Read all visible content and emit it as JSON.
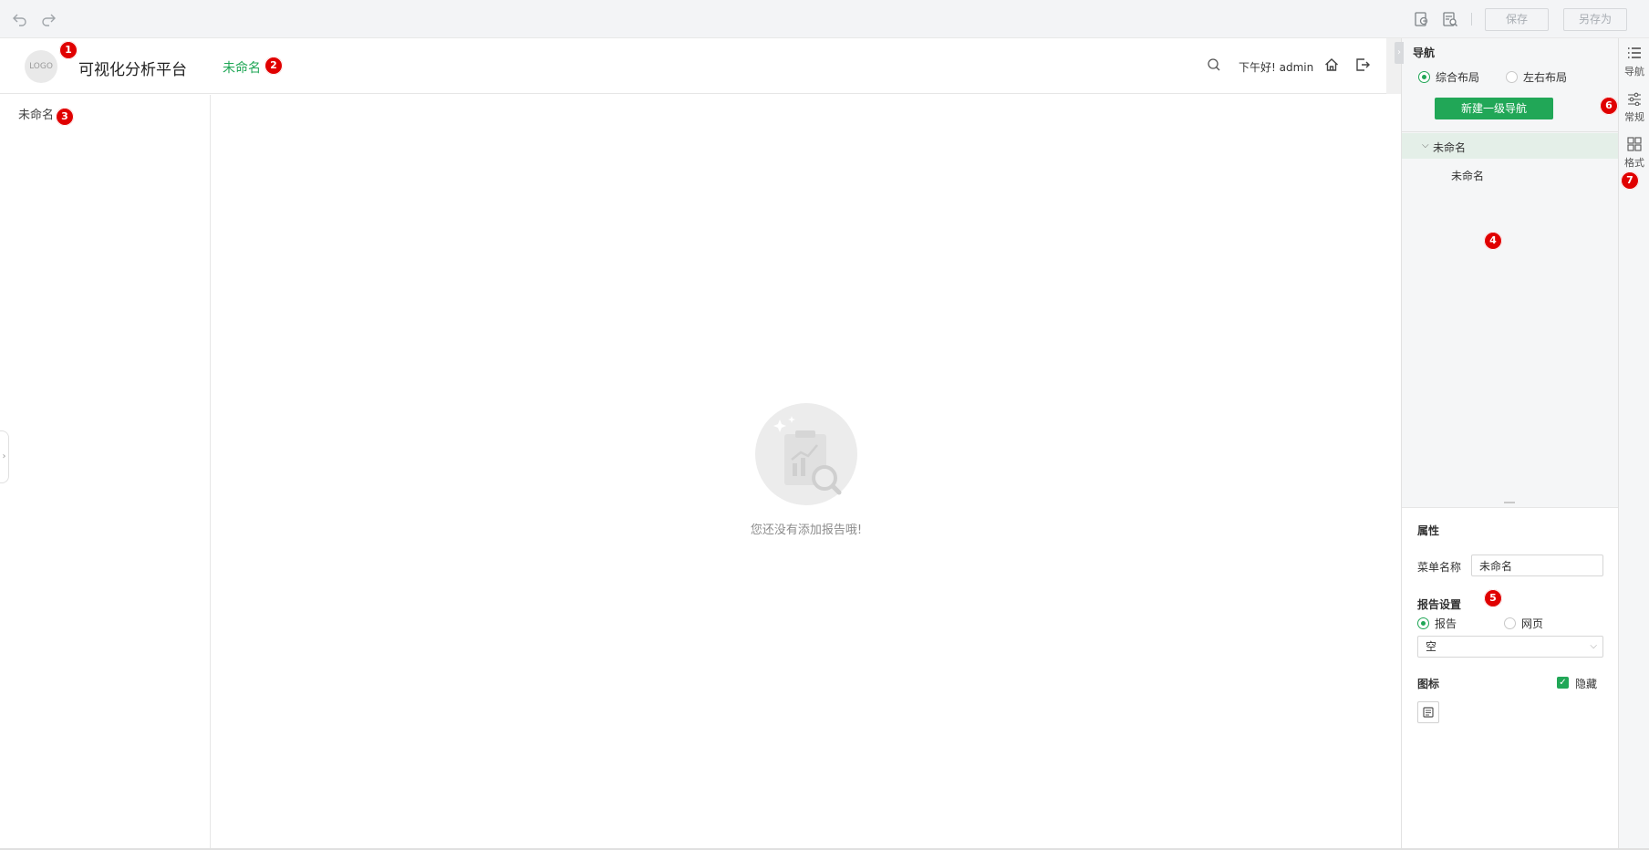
{
  "toolbar": {
    "save_label": "保存",
    "save_as_label": "另存为"
  },
  "header": {
    "logo_text": "LOGO",
    "platform_title": "可视化分析平台",
    "active_nav": "未命名",
    "greeting": "下午好! admin"
  },
  "sidebar": {
    "item": "未命名"
  },
  "main": {
    "empty_text": "您还没有添加报告哦!"
  },
  "nav_panel": {
    "title": "导航",
    "layout_option_1": "综合布局",
    "layout_option_2": "左右布局",
    "new_nav_button": "新建一级导航",
    "tree_parent": "未命名",
    "tree_child": "未命名"
  },
  "properties": {
    "title": "属性",
    "menu_name_label": "菜单名称",
    "menu_name_value": "未命名",
    "report_settings_label": "报告设置",
    "report_option": "报告",
    "webpage_option": "网页",
    "select_value": "空",
    "icon_label": "图标",
    "hide_label": "隐藏"
  },
  "right_tabs": {
    "nav": "导航",
    "general": "常规",
    "format": "格式"
  },
  "markers": [
    "1",
    "2",
    "3",
    "4",
    "5",
    "6",
    "7"
  ],
  "colors": {
    "accent": "#21a757",
    "marker": "#e00000"
  }
}
